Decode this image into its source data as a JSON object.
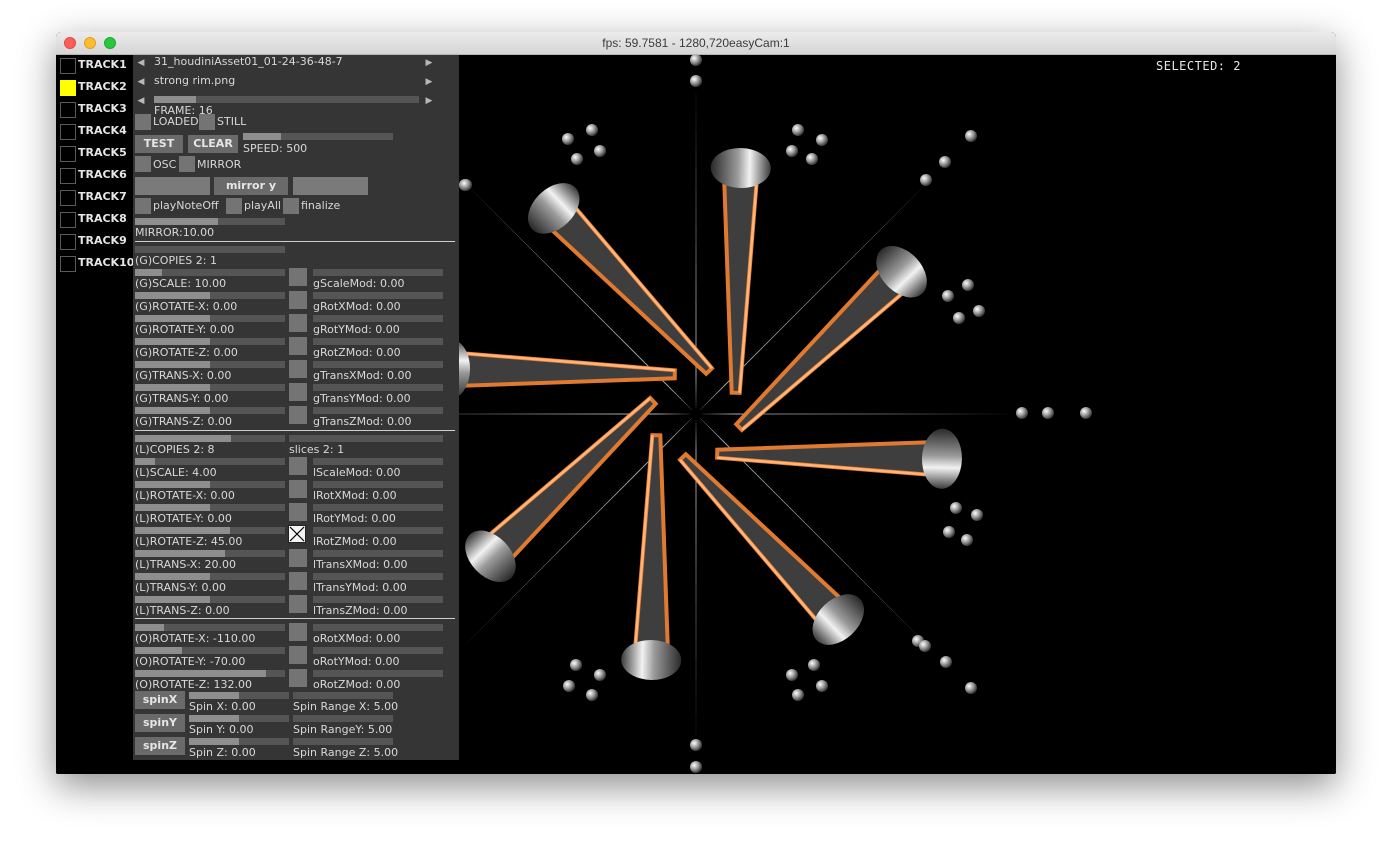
{
  "window": {
    "title": "fps: 59.7581 - 1280,720easyCam:1"
  },
  "hud": {
    "selected": "SELECTED: 2"
  },
  "tracks": [
    {
      "label": "TRACK1",
      "active": false
    },
    {
      "label": "TRACK2",
      "active": true
    },
    {
      "label": "TRACK3",
      "active": false
    },
    {
      "label": "TRACK4",
      "active": false
    },
    {
      "label": "TRACK5",
      "active": false
    },
    {
      "label": "TRACK6",
      "active": false
    },
    {
      "label": "TRACK7",
      "active": false
    },
    {
      "label": "TRACK8",
      "active": false
    },
    {
      "label": "TRACK9",
      "active": false
    },
    {
      "label": "TRACK10",
      "active": false
    }
  ],
  "panel": {
    "asset": "31_houdiniAsset01_01-24-36-48-7",
    "texture": "strong rim.png",
    "frame": "FRAME: 16",
    "frame_level": 0.16,
    "loaded": "LOADED",
    "still": "STILL",
    "test": "TEST",
    "clear": "CLEAR",
    "speed": "SPEED: 500",
    "speed_level": 0.25,
    "osc": "OSC",
    "mirror": "MIRROR",
    "mirror_y": "mirror y",
    "play_note_off": "playNoteOff",
    "play_all": "playAll",
    "finalize": "finalize",
    "mirror_value": "MIRROR:10.00",
    "mirror_level": 0.55,
    "g_copies": "(G)COPIES 2: 1",
    "global": [
      {
        "label": "(G)SCALE: 10.00",
        "level": 0.18,
        "mod": "gScaleMod: 0.00"
      },
      {
        "label": "(G)ROTATE-X: 0.00",
        "level": 0.5,
        "mod": "gRotXMod: 0.00"
      },
      {
        "label": "(G)ROTATE-Y: 0.00",
        "level": 0.5,
        "mod": "gRotYMod: 0.00"
      },
      {
        "label": "(G)ROTATE-Z: 0.00",
        "level": 0.5,
        "mod": "gRotZMod: 0.00"
      },
      {
        "label": "(G)TRANS-X: 0.00",
        "level": 0.5,
        "mod": "gTransXMod: 0.00"
      },
      {
        "label": "(G)TRANS-Y: 0.00",
        "level": 0.5,
        "mod": "gTransYMod: 0.00"
      },
      {
        "label": "(G)TRANS-Z: 0.00",
        "level": 0.5,
        "mod": "gTransZMod: 0.00"
      }
    ],
    "l_copies": "(L)COPIES 2: 8",
    "l_copies_level": 0.64,
    "slices": "slices 2: 1",
    "local": [
      {
        "label": "(L)SCALE: 4.00",
        "level": 0.13,
        "mod": "lScaleMod: 0.00"
      },
      {
        "label": "(L)ROTATE-X: 0.00",
        "level": 0.5,
        "mod": "lRotXMod: 0.00"
      },
      {
        "label": "(L)ROTATE-Y: 0.00",
        "level": 0.5,
        "mod": "lRotYMod: 0.00"
      },
      {
        "label": "(L)ROTATE-Z: 45.00",
        "level": 0.63,
        "mod": "lRotZMod: 0.00"
      },
      {
        "label": "(L)TRANS-X: 20.00",
        "level": 0.6,
        "mod": "lTransXMod: 0.00"
      },
      {
        "label": "(L)TRANS-Y: 0.00",
        "level": 0.5,
        "mod": "lTransYMod: 0.00"
      },
      {
        "label": "(L)TRANS-Z: 0.00",
        "level": 0.5,
        "mod": "lTransZMod: 0.00"
      }
    ],
    "object": [
      {
        "label": "(O)ROTATE-X: -110.00",
        "level": 0.19,
        "mod": "oRotXMod: 0.00"
      },
      {
        "label": "(O)ROTATE-Y: -70.00",
        "level": 0.31,
        "mod": "oRotYMod: 0.00"
      },
      {
        "label": "(O)ROTATE-Z: 132.00",
        "level": 0.87,
        "mod": "oRotZMod: 0.00"
      }
    ],
    "spin": [
      {
        "button": "spinX",
        "value": "Spin X: 0.00",
        "range": "Spin Range X: 5.00"
      },
      {
        "button": "spinY",
        "value": "Spin Y: 0.00",
        "range": "Spin RangeY: 5.00"
      },
      {
        "button": "spinZ",
        "value": "Spin Z: 0.00",
        "range": "Spin Range Z: 5.00"
      }
    ]
  }
}
